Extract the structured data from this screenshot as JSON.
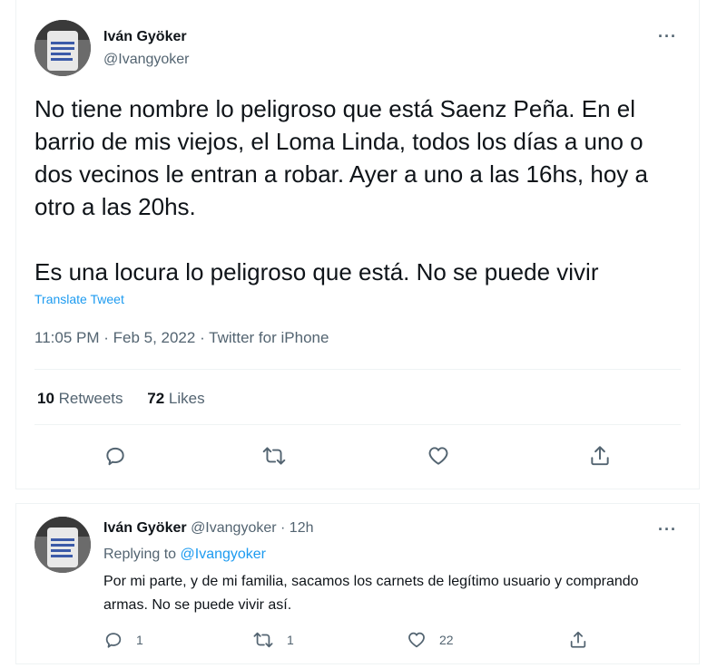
{
  "main_tweet": {
    "author_name": "Iván Gyöker",
    "author_handle": "@Ivangyoker",
    "paragraph1": "No tiene nombre lo peligroso que está Saenz Peña. En el barrio de mis viejos, el Loma Linda, todos los días a uno o dos vecinos le entran a robar. Ayer a uno a las 16hs, hoy a otro a las 20hs.",
    "paragraph2": "Es una locura lo peligroso que está. No se puede vivir",
    "translate_label": "Translate Tweet",
    "timestamp": "11:05 PM · Feb 5, 2022 · Twitter for iPhone",
    "retweets_count": "10",
    "retweets_label": "Retweets",
    "likes_count": "72",
    "likes_label": "Likes",
    "more_label": "···"
  },
  "reply_tweet": {
    "author_name": "Iván Gyöker",
    "author_handle": "@Ivangyoker · 12h",
    "replying_prefix": "Replying to",
    "replying_handle": "@Ivangyoker",
    "text": "Por mi parte, y de mi familia, sacamos los carnets de legítimo usuario y comprando armas. No se puede vivir así.",
    "reply_count": "1",
    "retweet_count": "1",
    "like_count": "22",
    "more_label": "···"
  },
  "icons": [
    "reply-icon",
    "retweet-icon",
    "like-icon",
    "share-icon",
    "more-icon"
  ],
  "colors": {
    "link": "#1d9bf0",
    "secondary": "#536471",
    "text": "#0f1419",
    "border": "#eff3f4"
  }
}
